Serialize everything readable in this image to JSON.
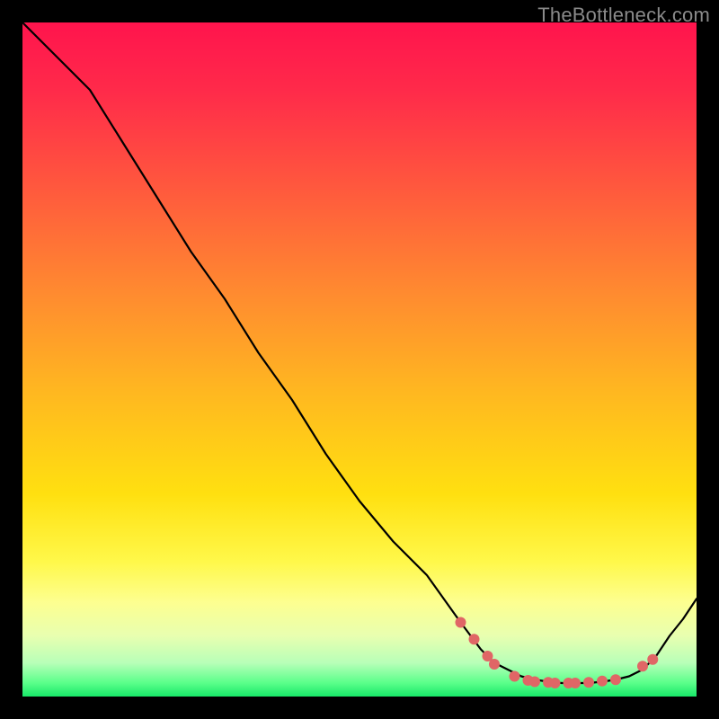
{
  "watermark": "TheBottleneck.com",
  "colors": {
    "background": "#000000",
    "line": "#000000",
    "dots": "#e06666"
  },
  "chart_data": {
    "type": "line",
    "title": "",
    "xlabel": "",
    "ylabel": "",
    "xlim": [
      0,
      1
    ],
    "ylim": [
      0,
      1
    ],
    "grid": false,
    "legend": false,
    "x": [
      0.0,
      0.05,
      0.1,
      0.15,
      0.2,
      0.25,
      0.3,
      0.35,
      0.4,
      0.45,
      0.5,
      0.55,
      0.6,
      0.65,
      0.68,
      0.7,
      0.72,
      0.74,
      0.76,
      0.78,
      0.8,
      0.82,
      0.84,
      0.86,
      0.88,
      0.9,
      0.92,
      0.94,
      0.96,
      0.98,
      1.0
    ],
    "y": [
      1.0,
      0.95,
      0.9,
      0.82,
      0.74,
      0.66,
      0.59,
      0.51,
      0.44,
      0.36,
      0.29,
      0.23,
      0.18,
      0.11,
      0.07,
      0.05,
      0.04,
      0.03,
      0.025,
      0.022,
      0.02,
      0.02,
      0.02,
      0.022,
      0.025,
      0.03,
      0.04,
      0.06,
      0.09,
      0.115,
      0.145
    ],
    "highlighted_points": [
      {
        "x": 0.65,
        "y": 0.11
      },
      {
        "x": 0.67,
        "y": 0.085
      },
      {
        "x": 0.69,
        "y": 0.06
      },
      {
        "x": 0.7,
        "y": 0.048
      },
      {
        "x": 0.73,
        "y": 0.03
      },
      {
        "x": 0.75,
        "y": 0.024
      },
      {
        "x": 0.76,
        "y": 0.022
      },
      {
        "x": 0.78,
        "y": 0.021
      },
      {
        "x": 0.79,
        "y": 0.02
      },
      {
        "x": 0.81,
        "y": 0.02
      },
      {
        "x": 0.82,
        "y": 0.02
      },
      {
        "x": 0.84,
        "y": 0.021
      },
      {
        "x": 0.86,
        "y": 0.023
      },
      {
        "x": 0.88,
        "y": 0.025
      },
      {
        "x": 0.92,
        "y": 0.045
      },
      {
        "x": 0.935,
        "y": 0.055
      }
    ]
  }
}
